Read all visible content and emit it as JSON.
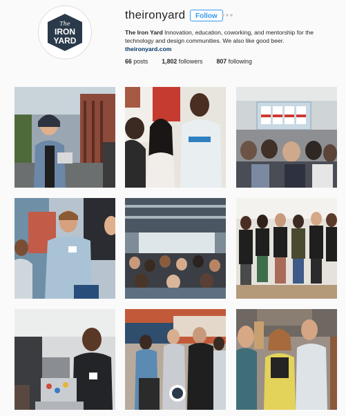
{
  "profile": {
    "username": "theironyard",
    "follow_label": "Follow",
    "more_icon": "more-dots-icon",
    "logo_text_top": "The",
    "logo_text_mid": "IRON",
    "logo_text_bot": "YARD",
    "bio_name": "The Iron Yard",
    "bio_text": " Innovation, education, coworking, and mentorship for the technology and design communities. We also like good beer.",
    "website": "theironyard.com",
    "posts_count": "66",
    "posts_label": "posts",
    "followers_count": "1,802",
    "followers_label": "followers",
    "following_count": "807",
    "following_label": "following"
  },
  "colors": {
    "accent": "#3897f0",
    "logo_navy": "#2b3a4a",
    "link": "#003569"
  },
  "photos": [
    {
      "label": "photo-woman-smiling-outdoors"
    },
    {
      "label": "photo-people-at-laptop"
    },
    {
      "label": "photo-presentation-audience"
    },
    {
      "label": "photo-man-with-name-tag"
    },
    {
      "label": "photo-crowded-event-room"
    },
    {
      "label": "photo-group-in-black-tshirts"
    },
    {
      "label": "photo-man-with-laptop"
    },
    {
      "label": "photo-people-mingling"
    },
    {
      "label": "photo-women-talking"
    }
  ]
}
